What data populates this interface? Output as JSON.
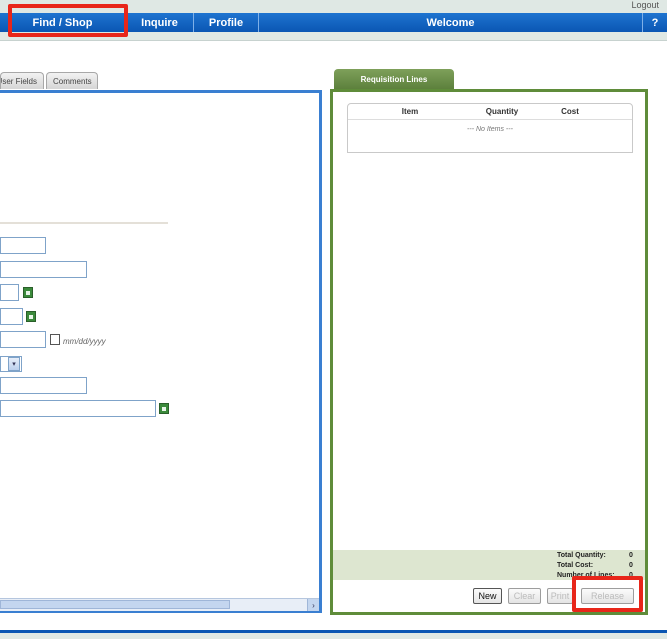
{
  "header": {
    "logout_label": "Logout"
  },
  "nav": {
    "find_shop": "Find / Shop",
    "inquire": "Inquire",
    "profile": "Profile",
    "welcome": "Welcome",
    "help": "?"
  },
  "left_tabs": {
    "user_fields": "User Fields",
    "comments": "Comments"
  },
  "form": {
    "date_format_hint": "mm/dd/yyyy",
    "select_arrow": "▾"
  },
  "requisition": {
    "tab_label": "Requisition Lines",
    "columns": [
      "Item",
      "Quantity",
      "Cost"
    ],
    "empty_message": "--- No Items ---",
    "totals": {
      "total_quantity_label": "Total Quantity:",
      "total_quantity_value": "0",
      "total_cost_label": "Total Cost:",
      "total_cost_value": "0",
      "number_of_lines_label": "Number of Lines:",
      "number_of_lines_value": "0"
    }
  },
  "buttons": {
    "new": "New",
    "clear": "Clear",
    "print": "Print",
    "release": "Release"
  },
  "colors": {
    "nav_blue": "#0a56b3",
    "left_panel_border": "#3a7fd1",
    "right_panel_border": "#5f8c3a",
    "highlight_red": "#e8261a"
  }
}
